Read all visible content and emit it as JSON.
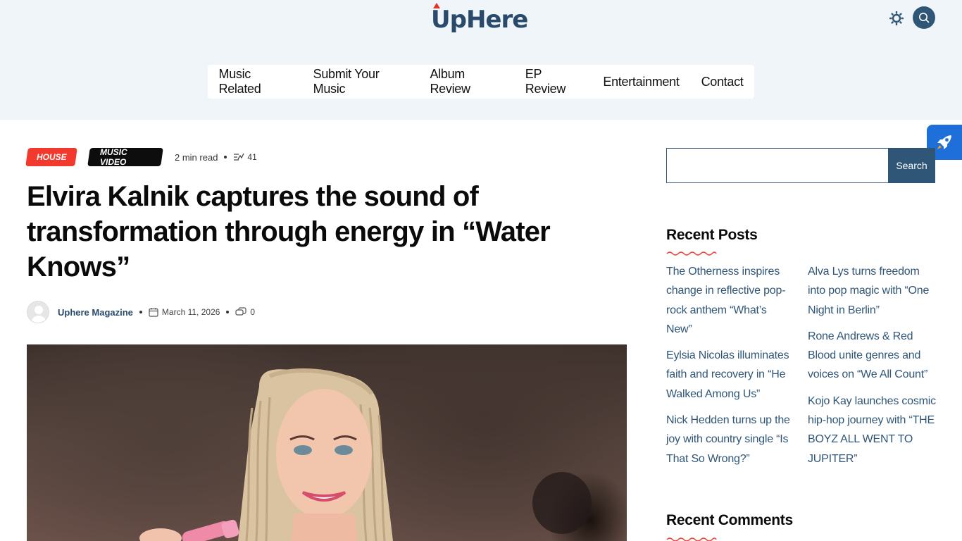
{
  "site": {
    "logo_text": "UpHere"
  },
  "nav": {
    "items": [
      "Music Related",
      "Submit Your Music",
      "Album Review",
      "EP Review",
      "Entertainment",
      "Contact"
    ]
  },
  "post": {
    "tags": [
      "HOUSE",
      "MUSIC VIDEO"
    ],
    "read_time": "2 min read",
    "views": "41",
    "title": "Elvira Kalnik captures the sound of transformation through energy in “Water Knows”",
    "author": "Uphere Magazine",
    "date": "March 11, 2026",
    "comments": "0"
  },
  "sidebar": {
    "search_button": "Search",
    "recent_posts_title": "Recent Posts",
    "recent_posts": [
      "The Otherness inspires change in reflective pop-rock anthem “What’s New”",
      "Alva Lys turns freedom into pop magic with “One Night in Berlin”",
      "Eylsia Nicolas illuminates faith and recovery in “He Walked Among Us”",
      "Rone Andrews & Red Blood unite genres and voices on “We All Count”",
      "Nick Hedden turns up the joy with country single “Is That So Wrong?”",
      "Kojo Kay launches cosmic hip-hop journey with “THE BOYZ ALL WENT TO JUPITER”"
    ],
    "recent_comments_title": "Recent Comments"
  },
  "colors": {
    "brand": "#2f5677",
    "accent_red": "#f2392d",
    "header_bg": "#f0f5fa"
  }
}
